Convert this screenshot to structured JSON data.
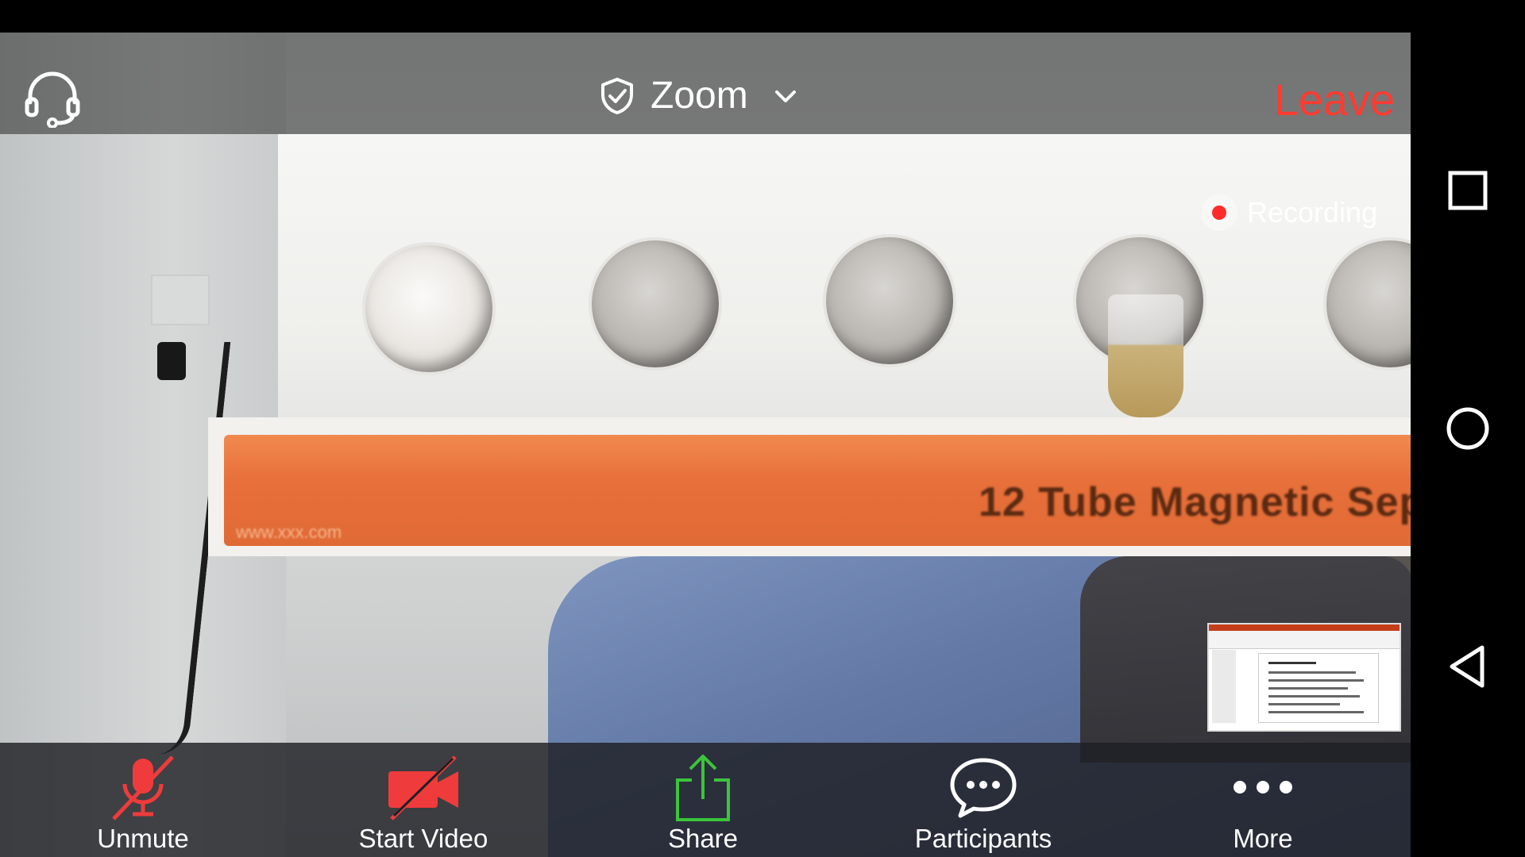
{
  "meeting": {
    "title": "Zoom",
    "leave_label": "Leave"
  },
  "recording": {
    "label": "Recording",
    "color": "#ff2b2b"
  },
  "video_scene": {
    "device_label": "12 Tube Magnetic Sep",
    "small_text": "www.xxx.com"
  },
  "toolbar": {
    "items": [
      {
        "label": "Unmute",
        "icon": "microphone-muted-icon",
        "color": "#ef3b3b"
      },
      {
        "label": "Start Video",
        "icon": "video-off-icon",
        "color": "#ef3b3b"
      },
      {
        "label": "Share",
        "icon": "share-upload-icon",
        "color": "#3cc43c"
      },
      {
        "label": "Participants",
        "icon": "chat-bubble-icon",
        "color": "#ffffff"
      },
      {
        "label": "More",
        "icon": "more-dots-icon",
        "color": "#ffffff"
      }
    ]
  },
  "system_nav": {
    "buttons": [
      "recents-square-icon",
      "home-circle-icon",
      "back-triangle-icon"
    ]
  },
  "colors": {
    "leave": "#ff3b30",
    "toolbar_bg": "#1e2024",
    "accent_green": "#3cc43c"
  }
}
